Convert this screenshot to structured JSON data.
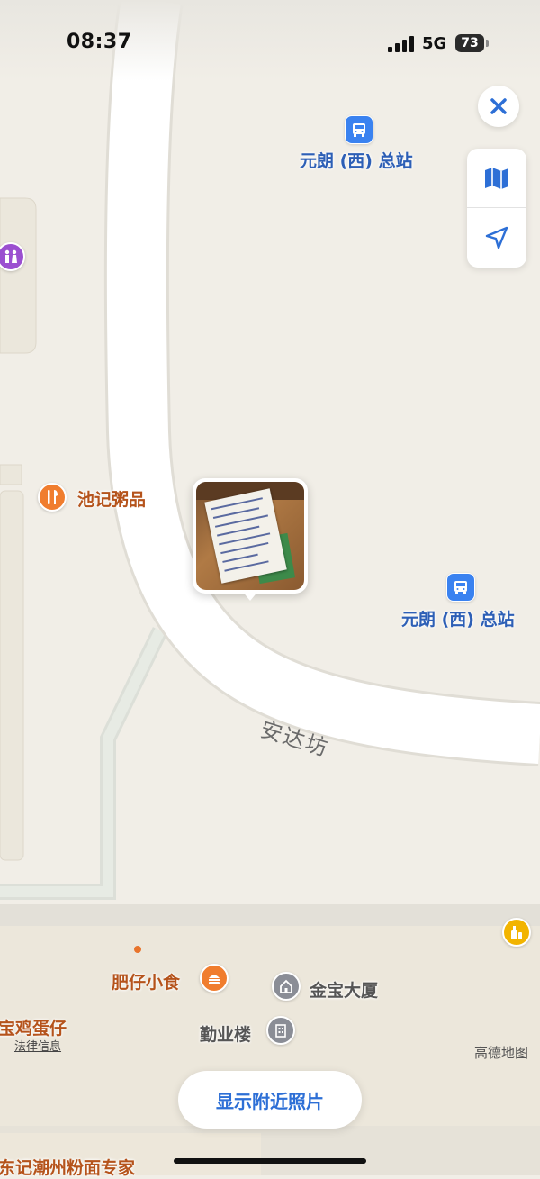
{
  "status_bar": {
    "time": "08:37",
    "network": "5G",
    "battery": "73"
  },
  "controls": {
    "close_icon": "close-icon",
    "map_mode_icon": "map-icon",
    "locate_icon": "location-arrow-icon"
  },
  "pois": {
    "bus_station_top": "元朗 (西) 总站",
    "bus_station_right": "元朗 (西) 总站",
    "congee": "池记粥品",
    "snack": "肥仔小食",
    "building_1": "金宝大厦",
    "building_2": "勤业楼",
    "egg_waffle": "宝鸡蛋仔",
    "noodles": "东记潮州粉面专家"
  },
  "road_name": "安达坊",
  "legal_link": "法律信息",
  "map_provider": "高德地图",
  "nearby_photos_button": "显示附近照片",
  "photo_note": "handwritten note photo",
  "colors": {
    "accent_blue": "#2d6fd6",
    "bus_icon": "#3a82f0",
    "food_icon": "#f07d2e",
    "restroom_icon": "#9b4fd0",
    "building_icon": "#8a8d96",
    "shop_icon": "#f2b400"
  }
}
